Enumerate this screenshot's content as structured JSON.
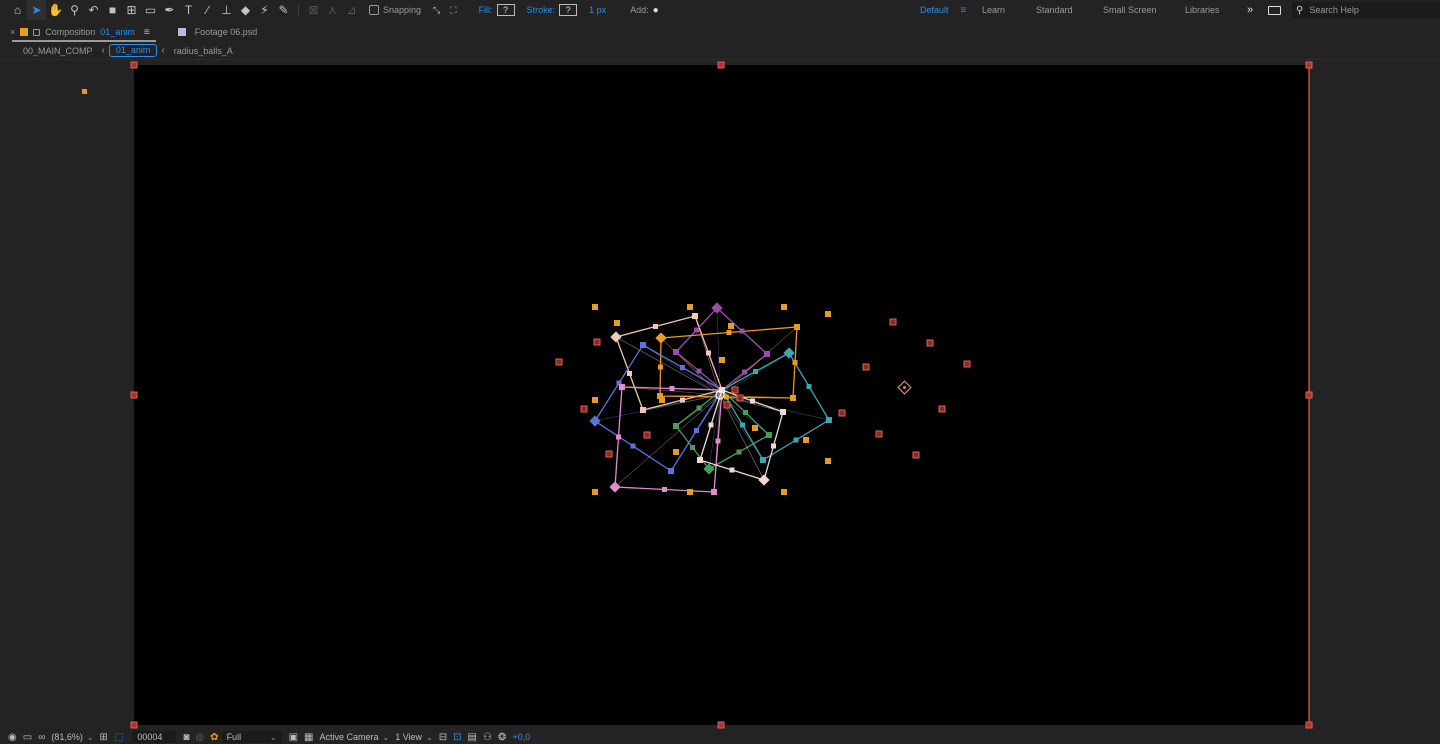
{
  "toolbar": {
    "tools": [
      {
        "icon": "home-icon",
        "glyph": "⌂"
      },
      {
        "icon": "selection-tool-icon",
        "glyph": "➤",
        "active": true
      },
      {
        "icon": "hand-tool-icon",
        "glyph": "✋"
      },
      {
        "icon": "zoom-tool-icon",
        "glyph": "⚲"
      },
      {
        "icon": "rotate-tool-icon",
        "glyph": "↶"
      },
      {
        "icon": "camera-tool-icon",
        "glyph": "■"
      },
      {
        "icon": "pan-behind-tool-icon",
        "glyph": "⊞"
      },
      {
        "icon": "rectangle-tool-icon",
        "glyph": "▭"
      },
      {
        "icon": "pen-tool-icon",
        "glyph": "✒"
      },
      {
        "icon": "type-tool-icon",
        "glyph": "T"
      },
      {
        "icon": "brush-tool-icon",
        "glyph": "∕"
      },
      {
        "icon": "clone-stamp-tool-icon",
        "glyph": "⊥"
      },
      {
        "icon": "eraser-tool-icon",
        "glyph": "◆"
      },
      {
        "icon": "roto-brush-tool-icon",
        "glyph": "⚡"
      },
      {
        "icon": "puppet-pin-tool-icon",
        "glyph": "✎"
      }
    ],
    "snapping_label": "Snapping",
    "fill_label": "Fill:",
    "fill_value": "?",
    "stroke_label": "Stroke:",
    "stroke_value": "?",
    "stroke_width": "1 px",
    "add_label": "Add:",
    "workspaces": {
      "default": "Default",
      "learn": "Learn",
      "standard": "Standard",
      "small_screen": "Small Screen",
      "libraries": "Libraries"
    },
    "search_placeholder": "Search Help"
  },
  "panel_tabs": {
    "composition_label": "Composition",
    "composition_name": "01_anim",
    "footage_label": "Footage 06.psd"
  },
  "breadcrumbs": [
    "00_MAIN_COMP",
    "01_anim",
    "radius_balls_A"
  ],
  "bottom_bar": {
    "magnification": "(81,6%)",
    "timecode": "00004",
    "resolution": "Full",
    "camera": "Active Camera",
    "views": "1 View",
    "exposure": "+0,0"
  },
  "colors": {
    "accent_blue": "#2d8ceb",
    "panel_bg": "#232323",
    "canvas_bg": "#000000",
    "handle_orange": "#e79b24",
    "bounds_red": "#e0614f"
  }
}
